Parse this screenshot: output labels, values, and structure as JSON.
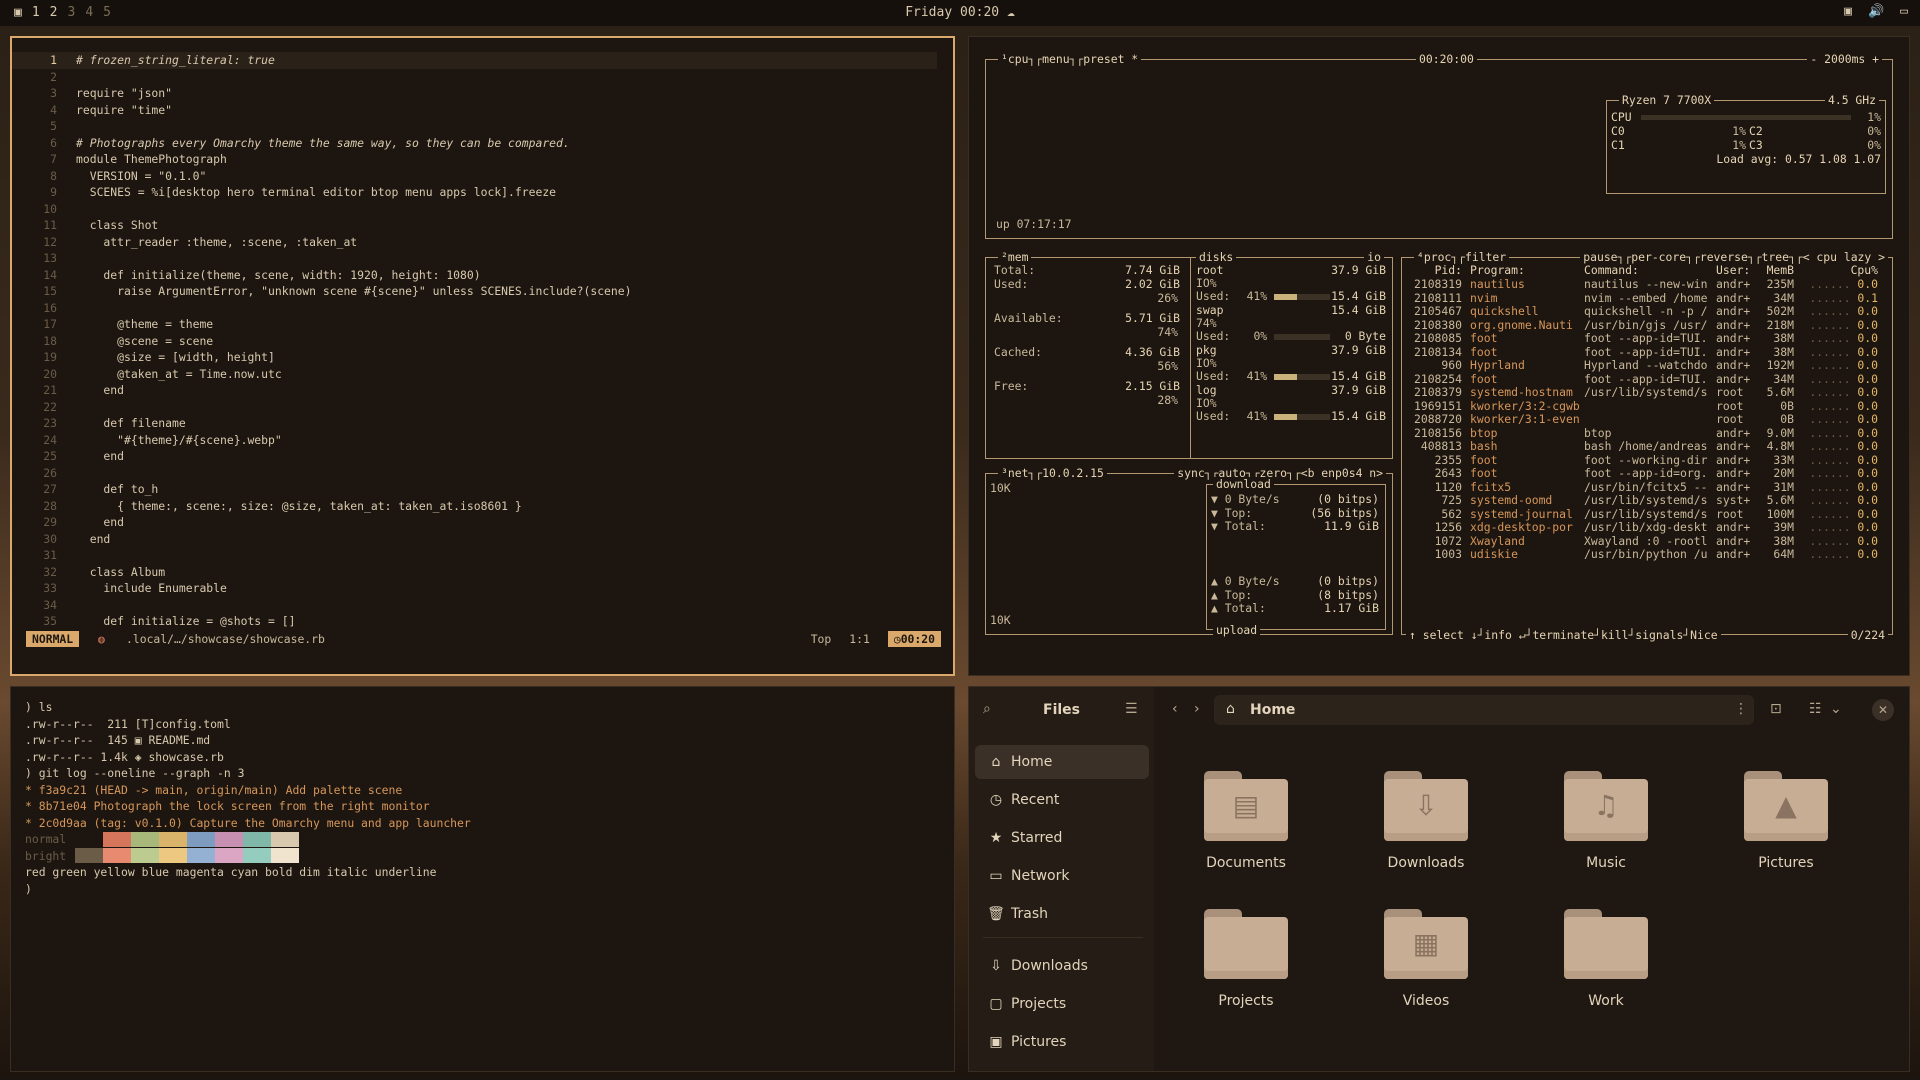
{
  "topbar": {
    "workspaces": [
      "1",
      "2",
      "3",
      "4",
      "5"
    ],
    "clock": "Friday 00:20",
    "clock_icon": "cloud-icon",
    "tray_icons": [
      "screen-icon",
      "volume-icon",
      "display-icon"
    ]
  },
  "editor": {
    "lines": [
      {
        "n": "1",
        "code": "# frozen_string_literal: true"
      },
      {
        "n": "2",
        "code": ""
      },
      {
        "n": "3",
        "code": "require \"json\""
      },
      {
        "n": "4",
        "code": "require \"time\""
      },
      {
        "n": "5",
        "code": ""
      },
      {
        "n": "6",
        "code": "# Photographs every Omarchy theme the same way, so they can be compared."
      },
      {
        "n": "7",
        "code": "module ThemePhotograph"
      },
      {
        "n": "8",
        "code": "  VERSION = \"0.1.0\""
      },
      {
        "n": "9",
        "code": "  SCENES = %i[desktop hero terminal editor btop menu apps lock].freeze"
      },
      {
        "n": "10",
        "code": ""
      },
      {
        "n": "11",
        "code": "  class Shot"
      },
      {
        "n": "12",
        "code": "    attr_reader :theme, :scene, :taken_at"
      },
      {
        "n": "13",
        "code": ""
      },
      {
        "n": "14",
        "code": "    def initialize(theme, scene, width: 1920, height: 1080)"
      },
      {
        "n": "15",
        "code": "      raise ArgumentError, \"unknown scene #{scene}\" unless SCENES.include?(scene)"
      },
      {
        "n": "16",
        "code": ""
      },
      {
        "n": "17",
        "code": "      @theme = theme"
      },
      {
        "n": "18",
        "code": "      @scene = scene"
      },
      {
        "n": "19",
        "code": "      @size = [width, height]"
      },
      {
        "n": "20",
        "code": "      @taken_at = Time.now.utc"
      },
      {
        "n": "21",
        "code": "    end"
      },
      {
        "n": "22",
        "code": ""
      },
      {
        "n": "23",
        "code": "    def filename"
      },
      {
        "n": "24",
        "code": "      \"#{theme}/#{scene}.webp\""
      },
      {
        "n": "25",
        "code": "    end"
      },
      {
        "n": "26",
        "code": ""
      },
      {
        "n": "27",
        "code": "    def to_h"
      },
      {
        "n": "28",
        "code": "      { theme:, scene:, size: @size, taken_at: taken_at.iso8601 }"
      },
      {
        "n": "29",
        "code": "    end"
      },
      {
        "n": "30",
        "code": "  end"
      },
      {
        "n": "31",
        "code": ""
      },
      {
        "n": "32",
        "code": "  class Album"
      },
      {
        "n": "33",
        "code": "    include Enumerable"
      },
      {
        "n": "34",
        "code": ""
      },
      {
        "n": "35",
        "code": "    def initialize = @shots = []"
      }
    ],
    "status": {
      "mode": "NORMAL",
      "file": ".local/…/showcase/showcase.rb",
      "scroll": "Top",
      "cursor": "1:1",
      "time": "00:20"
    }
  },
  "btop": {
    "cpu_title": "¹cpu┐┌menu┐┌preset *",
    "clock": "00:20:00",
    "interval": "- 2000ms +",
    "cpu_name": "Ryzen 7 7700X",
    "freq": "4.5 GHz",
    "cpu_total": {
      "label": "CPU",
      "pct": "1%"
    },
    "cores": [
      {
        "label": "C0",
        "pct": "1%"
      },
      {
        "label": "C2",
        "pct": "0%"
      },
      {
        "label": "C1",
        "pct": "1%"
      },
      {
        "label": "C3",
        "pct": "0%"
      }
    ],
    "load": "Load avg: 0.57 1.08 1.07",
    "uptime": "up 07:17:17",
    "mem": {
      "title": "²mem",
      "total": {
        "label": "Total:",
        "val": "7.74 GiB"
      },
      "used": {
        "label": "Used:",
        "val": "2.02 GiB",
        "pct": "26%"
      },
      "avail": {
        "label": "Available:",
        "val": "5.71 GiB",
        "pct": "74%"
      },
      "cached": {
        "label": "Cached:",
        "val": "4.36 GiB",
        "pct": "56%"
      },
      "free": {
        "label": "Free:",
        "val": "2.15 GiB",
        "pct": "28%"
      }
    },
    "disks": {
      "title": "disks",
      "io": "io",
      "items": [
        {
          "name": "root",
          "size": "37.9 GiB",
          "io": "IO%",
          "used_label": "Used:",
          "used_pct": "41%",
          "used_size": "15.4 GiB",
          "fill": 0.41
        },
        {
          "name": "swap",
          "size": "15.4 GiB",
          "io": "74%",
          "used_label": "Used:",
          "used_pct": "0%",
          "used_size": "0 Byte",
          "fill": 0
        },
        {
          "name": "pkg",
          "size": "37.9 GiB",
          "io": "IO%",
          "used_label": "Used:",
          "used_pct": "41%",
          "used_size": "15.4 GiB",
          "fill": 0.41
        },
        {
          "name": "log",
          "size": "37.9 GiB",
          "io": "IO%",
          "used_label": "Used:",
          "used_pct": "41%",
          "used_size": "15.4 GiB",
          "fill": 0.41
        }
      ]
    },
    "net": {
      "title": "³net┐┌10.0.2.15",
      "opts": "sync┐┌auto┐┌zero┐┌<b enp0s4 n>",
      "scale_top": "10K",
      "scale_bottom": "10K",
      "download": "download",
      "upload": "upload",
      "down": [
        {
          "l": "▼ 0 Byte/s",
          "r": "(0 bitps)"
        },
        {
          "l": "▼ Top:",
          "r": "(56 bitps)"
        },
        {
          "l": "▼ Total:",
          "r": "11.9 GiB"
        }
      ],
      "up": [
        {
          "l": "▲ 0 Byte/s",
          "r": "(0 bitps)"
        },
        {
          "l": "▲ Top:",
          "r": "(8 bitps)"
        },
        {
          "l": "▲ Total:",
          "r": "1.17 GiB"
        }
      ]
    },
    "proc": {
      "title": "⁴proc┐┌filter",
      "opts": "pause┐┌per-core┐┌reverse┐┌tree┐┌< cpu lazy >",
      "headers": {
        "pid": "Pid:",
        "prog": "Program:",
        "cmd": "Command:",
        "user": "User:",
        "mem": "MemB",
        "cpu": "Cpu%"
      },
      "rows": [
        {
          "pid": "2108319",
          "prog": "nautilus",
          "cmd": "nautilus --new-win",
          "user": "andr+",
          "mem": "235M",
          "cpu": "0.0"
        },
        {
          "pid": "2108111",
          "prog": "nvim",
          "cmd": "nvim --embed /home",
          "user": "andr+",
          "mem": "34M",
          "cpu": "0.1"
        },
        {
          "pid": "2105467",
          "prog": "quickshell",
          "cmd": "quickshell -n -p /",
          "user": "andr+",
          "mem": "502M",
          "cpu": "0.0"
        },
        {
          "pid": "2108380",
          "prog": "org.gnome.Nauti",
          "cmd": "/usr/bin/gjs /usr/",
          "user": "andr+",
          "mem": "218M",
          "cpu": "0.0"
        },
        {
          "pid": "2108085",
          "prog": "foot",
          "cmd": "foot --app-id=TUI.",
          "user": "andr+",
          "mem": "38M",
          "cpu": "0.0"
        },
        {
          "pid": "2108134",
          "prog": "foot",
          "cmd": "foot --app-id=TUI.",
          "user": "andr+",
          "mem": "38M",
          "cpu": "0.0"
        },
        {
          "pid": "960",
          "prog": "Hyprland",
          "cmd": "Hyprland --watchdo",
          "user": "andr+",
          "mem": "192M",
          "cpu": "0.0"
        },
        {
          "pid": "2108254",
          "prog": "foot",
          "cmd": "foot --app-id=TUI.",
          "user": "andr+",
          "mem": "34M",
          "cpu": "0.0"
        },
        {
          "pid": "2108379",
          "prog": "systemd-hostnam",
          "cmd": "/usr/lib/systemd/s",
          "user": "root",
          "mem": "5.6M",
          "cpu": "0.0"
        },
        {
          "pid": "1969151",
          "prog": "kworker/3:2-cgwb",
          "cmd": "",
          "user": "root",
          "mem": "0B",
          "cpu": "0.0"
        },
        {
          "pid": "2088720",
          "prog": "kworker/3:1-even",
          "cmd": "",
          "user": "root",
          "mem": "0B",
          "cpu": "0.0"
        },
        {
          "pid": "2108156",
          "prog": "btop",
          "cmd": "btop",
          "user": "andr+",
          "mem": "9.0M",
          "cpu": "0.0"
        },
        {
          "pid": "408813",
          "prog": "bash",
          "cmd": "bash /home/andreas",
          "user": "andr+",
          "mem": "4.8M",
          "cpu": "0.0"
        },
        {
          "pid": "2355",
          "prog": "foot",
          "cmd": "foot --working-dir",
          "user": "andr+",
          "mem": "33M",
          "cpu": "0.0"
        },
        {
          "pid": "2643",
          "prog": "foot",
          "cmd": "foot --app-id=org.",
          "user": "andr+",
          "mem": "20M",
          "cpu": "0.0"
        },
        {
          "pid": "1120",
          "prog": "fcitx5",
          "cmd": "/usr/bin/fcitx5 --",
          "user": "andr+",
          "mem": "31M",
          "cpu": "0.0"
        },
        {
          "pid": "725",
          "prog": "systemd-oomd",
          "cmd": "/usr/lib/systemd/s",
          "user": "syst+",
          "mem": "5.6M",
          "cpu": "0.0"
        },
        {
          "pid": "562",
          "prog": "systemd-journal",
          "cmd": "/usr/lib/systemd/s",
          "user": "root",
          "mem": "100M",
          "cpu": "0.0"
        },
        {
          "pid": "1256",
          "prog": "xdg-desktop-por",
          "cmd": "/usr/lib/xdg-deskt",
          "user": "andr+",
          "mem": "39M",
          "cpu": "0.0"
        },
        {
          "pid": "1072",
          "prog": "Xwayland",
          "cmd": "Xwayland :0 -rootl",
          "user": "andr+",
          "mem": "38M",
          "cpu": "0.0"
        },
        {
          "pid": "1003",
          "prog": "udiskie",
          "cmd": "/usr/bin/python /u",
          "user": "andr+",
          "mem": "64M",
          "cpu": "0.0"
        }
      ],
      "footer": "↑ select ↓┘info ↵┘terminate┘kill┘signals┘Nice",
      "count": "0/224"
    }
  },
  "terminal": {
    "lines": [
      ") ls",
      ".rw-r--r--  211 [T]config.toml",
      ".rw-r--r--  145 ▣ README.md",
      ".rw-r--r-- 1.4k ◈ showcase.rb",
      ") git log --oneline --graph -n 3",
      "* f3a9c21 (HEAD -> main, origin/main) Add palette scene",
      "* 8b71e04 Photograph the lock screen from the right monitor",
      "* 2c0d9aa (tag: v0.1.0) Capture the Omarchy menu and app launcher",
      "normal",
      "bright",
      "red green yellow blue magenta cyan bold dim italic underline",
      ")"
    ],
    "palette_normal": [
      "#1d1610",
      "#d4755c",
      "#a8b87a",
      "#d9b36a",
      "#7d9cbf",
      "#c790b0",
      "#7fb8a8",
      "#d8c8ad"
    ],
    "palette_bright": [
      "#6b5c48",
      "#e88a6f",
      "#bccb8f",
      "#edc880",
      "#94b1d3",
      "#dba5c4",
      "#94cdbd",
      "#f0e4cf"
    ]
  },
  "files": {
    "title": "Files",
    "path": "Home",
    "sidebar": [
      {
        "label": "Home",
        "icon": "home-icon",
        "glyph": "⌂",
        "selected": true
      },
      {
        "label": "Recent",
        "icon": "clock-icon",
        "glyph": "◷"
      },
      {
        "label": "Starred",
        "icon": "star-icon",
        "glyph": "★"
      },
      {
        "label": "Network",
        "icon": "network-icon",
        "glyph": "▭"
      },
      {
        "label": "Trash",
        "icon": "trash-icon",
        "glyph": "🗑"
      },
      {
        "label": "Downloads",
        "icon": "download-icon",
        "glyph": "⇩"
      },
      {
        "label": "Projects",
        "icon": "folder-icon",
        "glyph": "▢"
      },
      {
        "label": "Pictures",
        "icon": "image-icon",
        "glyph": "▣"
      }
    ],
    "folders": [
      {
        "label": "Documents",
        "icon": "document-folder-icon",
        "glyph": "▤"
      },
      {
        "label": "Downloads",
        "icon": "download-folder-icon",
        "glyph": "⇩"
      },
      {
        "label": "Music",
        "icon": "music-folder-icon",
        "glyph": "♫"
      },
      {
        "label": "Pictures",
        "icon": "pictures-folder-icon",
        "glyph": "▲"
      },
      {
        "label": "Projects",
        "icon": "folder-icon",
        "glyph": ""
      },
      {
        "label": "Videos",
        "icon": "video-folder-icon",
        "glyph": "▦"
      },
      {
        "label": "Work",
        "icon": "folder-icon",
        "glyph": ""
      }
    ]
  }
}
